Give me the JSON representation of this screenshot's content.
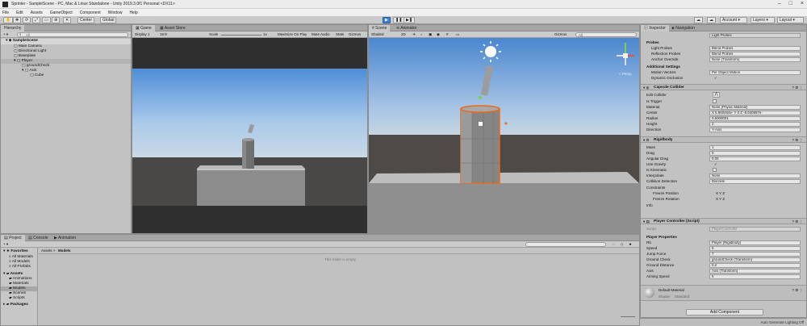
{
  "window": {
    "title": "Sprinter - SampleScene - PC, Mac & Linux Standalone - Unity 2019.3.0f1 Personal <DX11>"
  },
  "menu": [
    "File",
    "Edit",
    "Assets",
    "GameObject",
    "Component",
    "Window",
    "Help"
  ],
  "toolbar": {
    "pivot": "Center",
    "space": "Global",
    "account": "Account",
    "layers": "Layers",
    "layout": "Layout"
  },
  "hierarchy": {
    "tab": "Hierarchy",
    "search_placeholder": "All",
    "items": [
      {
        "label": "SampleScene",
        "depth": 0
      },
      {
        "label": "Main Camera",
        "depth": 1
      },
      {
        "label": "Directional Light",
        "depth": 1
      },
      {
        "label": "Baseplate",
        "depth": 1
      },
      {
        "label": "Player",
        "depth": 1
      },
      {
        "label": "groundCheck",
        "depth": 2
      },
      {
        "label": "Axis",
        "depth": 2
      },
      {
        "label": "Cube",
        "depth": 3
      }
    ]
  },
  "game": {
    "tabs": [
      "Game",
      "Asset Store"
    ],
    "display": "Display 1",
    "aspect": "16:9",
    "scale_label": "Scale",
    "scale_value": "1x",
    "options": [
      "Maximize On Play",
      "Mute Audio",
      "Stats",
      "Gizmos"
    ]
  },
  "scene": {
    "tabs": [
      "Scene",
      "Animator"
    ],
    "shading": "Shaded",
    "mode": "2D",
    "gizmos": "Gizmos",
    "search_placeholder": "All",
    "persp_label": "< Persp"
  },
  "project": {
    "tabs": [
      "Project",
      "Console",
      "Animation"
    ],
    "favorites_label": "Favorites",
    "favorites": [
      "All Materials",
      "All Models",
      "All Prefabs"
    ],
    "assets_label": "Assets",
    "assets": [
      "Animations",
      "Materials",
      "Models",
      "Scenes",
      "Scripts"
    ],
    "packages_label": "Packages",
    "breadcrumb": [
      "Assets",
      "Models"
    ],
    "empty_message": "This folder is empty"
  },
  "inspector": {
    "tabs": [
      "Inspector",
      "Navigation"
    ],
    "top_rows": [
      {
        "label": "",
        "value": "Light Probes"
      }
    ],
    "probes": {
      "header": "Probes",
      "rows": [
        {
          "label": "Light Probes",
          "value": "Blend Probes"
        },
        {
          "label": "Reflection Probes",
          "value": "Blend Probes"
        },
        {
          "label": "Anchor Override",
          "value": "None (Transform)"
        }
      ]
    },
    "additional": {
      "header": "Additional Settings",
      "rows": [
        {
          "label": "Motion Vectors",
          "value": "Per Object Motion"
        },
        {
          "label": "Dynamic Occlusion",
          "value": "✓"
        }
      ]
    },
    "capsule": {
      "header": "Capsule Collider",
      "rows": [
        {
          "label": "Edit Collider",
          "value": ""
        },
        {
          "label": "Is Trigger",
          "value": ""
        },
        {
          "label": "Material",
          "value": "None (Physic Material)"
        },
        {
          "label": "Center",
          "value": "X 5.960464e-  Y 0      Z -8.940697e-"
        },
        {
          "label": "Radius",
          "value": "0.5000001"
        },
        {
          "label": "Height",
          "value": "2"
        },
        {
          "label": "Direction",
          "value": "Y-Axis"
        }
      ]
    },
    "rigidbody": {
      "header": "Rigidbody",
      "rows": [
        {
          "label": "Mass",
          "value": "1"
        },
        {
          "label": "Drag",
          "value": "0"
        },
        {
          "label": "Angular Drag",
          "value": "0.05"
        },
        {
          "label": "Use Gravity",
          "value": "✓"
        },
        {
          "label": "Is Kinematic",
          "value": ""
        },
        {
          "label": "Interpolate",
          "value": "None"
        },
        {
          "label": "Collision Detection",
          "value": "Discrete"
        }
      ],
      "constraints_label": "Constraints",
      "freeze_position": "Freeze Position",
      "freeze_position_value": "X  Y  Z",
      "freeze_rotation": "Freeze Rotation",
      "freeze_rotation_value": "X  Y  Z",
      "info": "Info"
    },
    "player": {
      "header": "Player Controller (Script)",
      "script_label": "Script",
      "script_value": "PlayerController",
      "props_header": "Player Properties",
      "rows": [
        {
          "label": "Rb",
          "value": "Player (Rigidbody)"
        },
        {
          "label": "Speed",
          "value": "5"
        },
        {
          "label": "Jump Force",
          "value": "7"
        },
        {
          "label": "Ground Check",
          "value": "groundCheck (Transform)"
        },
        {
          "label": "Ground Distance",
          "value": "0.2"
        },
        {
          "label": "Axis",
          "value": "Axis (Transform)"
        },
        {
          "label": "Aiming Speed",
          "value": "5"
        }
      ]
    },
    "material": {
      "name": "Default-Material",
      "shader_label": "Shader",
      "shader_value": "Standard"
    },
    "add_component": "Add Component"
  },
  "status": {
    "lighting": "Auto Generate Lighting Off"
  },
  "colors": {
    "accent": "#3d7fd6",
    "selection_outline": "#e86a1a",
    "sky_top": "#4d8ed8",
    "ground": "#3a3a3a"
  }
}
